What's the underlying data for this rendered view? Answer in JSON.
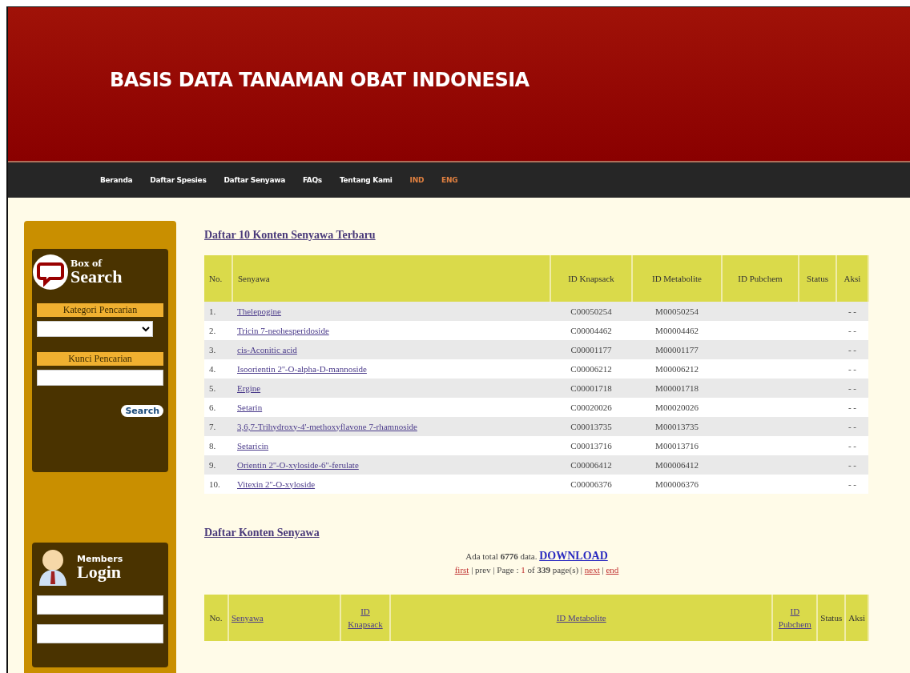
{
  "header": {
    "title": "BASIS DATA TANAMAN OBAT INDONESIA"
  },
  "nav": [
    {
      "label": "Beranda",
      "kind": "page"
    },
    {
      "label": "Daftar Spesies",
      "kind": "page"
    },
    {
      "label": "Daftar Senyawa",
      "kind": "page"
    },
    {
      "label": "FAQs",
      "kind": "page"
    },
    {
      "label": "Tentang Kami",
      "kind": "page"
    },
    {
      "label": "IND",
      "kind": "lang"
    },
    {
      "label": "ENG",
      "kind": "lang"
    }
  ],
  "search_box": {
    "title_small": "Box of",
    "title_big": "Search",
    "category_label": "Kategori Pencarian",
    "keyword_label": "Kunci Pencarian",
    "button": "Search"
  },
  "login_box": {
    "title_small": "Members",
    "title_big": "Login"
  },
  "latest": {
    "heading": "Daftar 10 Konten Senyawa Terbaru",
    "columns": [
      "No.",
      "Senyawa",
      "ID Knapsack",
      "ID Metabolite",
      "ID Pubchem",
      "Status",
      "Aksi"
    ],
    "rows": [
      [
        "1.",
        "Thelepogine",
        "C00050254",
        "M00050254",
        "",
        "",
        "- -"
      ],
      [
        "2.",
        "Tricin 7-neohesperidoside",
        "C00004462",
        "M00004462",
        "",
        "",
        "- -"
      ],
      [
        "3.",
        "cis-Aconitic acid",
        "C00001177",
        "M00001177",
        "",
        "",
        "- -"
      ],
      [
        "4.",
        "Isoorientin 2''-O-alpha-D-mannoside",
        "C00006212",
        "M00006212",
        "",
        "",
        "- -"
      ],
      [
        "5.",
        "Ergine",
        "C00001718",
        "M00001718",
        "",
        "",
        "- -"
      ],
      [
        "6.",
        "Setarin",
        "C00020026",
        "M00020026",
        "",
        "",
        "- -"
      ],
      [
        "7.",
        "3,6,7-Trihydroxy-4'-methoxyflavone 7-rhamnoside",
        "C00013735",
        "M00013735",
        "",
        "",
        "- -"
      ],
      [
        "8.",
        "Setaricin",
        "C00013716",
        "M00013716",
        "",
        "",
        "- -"
      ],
      [
        "9.",
        "Orientin 2''-O-xyloside-6''-ferulate",
        "C00006412",
        "M00006412",
        "",
        "",
        "- -"
      ],
      [
        "10.",
        "Vitexin 2''-O-xyloside",
        "C00006376",
        "M00006376",
        "",
        "",
        "- -"
      ]
    ]
  },
  "all": {
    "heading": "Daftar Konten Senyawa",
    "total_prefix": "Ada total",
    "total": "6776",
    "total_suffix": "data.",
    "download": "DOWNLOAD",
    "pager": {
      "separator": "|",
      "first": "first",
      "prev": "prev",
      "page_label": "Page :",
      "page": "1",
      "of": "of",
      "pages": "339",
      "pages_suffix": "page(s)",
      "next": "next",
      "end": "end"
    },
    "columns": [
      {
        "label": "No.",
        "link": false
      },
      {
        "label": "Senyawa",
        "link": true
      },
      {
        "label": "ID Knapsack",
        "link": true
      },
      {
        "label": "ID Metabolite",
        "link": true
      },
      {
        "label": "ID Pubchem",
        "link": true
      },
      {
        "label": "Status",
        "link": false
      },
      {
        "label": "Aksi",
        "link": false
      }
    ]
  }
}
